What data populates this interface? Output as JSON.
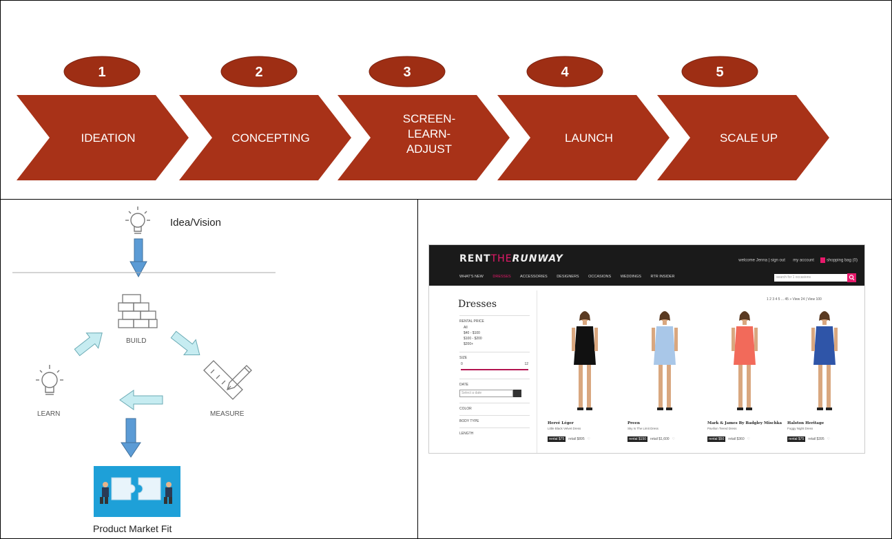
{
  "process": {
    "steps": [
      {
        "number": "1",
        "label": "IDEATION"
      },
      {
        "number": "2",
        "label": "CONCEPTING"
      },
      {
        "number": "3",
        "label_lines": [
          "SCREEN-",
          "LEARN-",
          "ADJUST"
        ]
      },
      {
        "number": "4",
        "label": "LAUNCH"
      },
      {
        "number": "5",
        "label": "SCALE UP"
      }
    ],
    "colors": {
      "chevron": "#a83218",
      "badge": "#9e2e14",
      "text": "#ffffff"
    }
  },
  "lean_cycle": {
    "vision_label": "Idea/Vision",
    "build_label": "BUILD",
    "measure_label": "MEASURE",
    "learn_label": "LEARN",
    "outcome_label": "Product Market Fit",
    "arrow_color": "#5b9bd5",
    "cycle_arrow_color": "#c6ecf1",
    "icons": [
      "lightbulb-icon",
      "brick-wall-icon",
      "ruler-pencil-icon",
      "lightbulb-icon",
      "puzzle-handshake-image"
    ]
  },
  "website": {
    "logo_parts": [
      "RENT",
      "THE",
      "RUNWAY"
    ],
    "header_links": [
      "welcome Jenna | sign out",
      "my account",
      "shopping bag (0)"
    ],
    "nav": [
      "WHAT'S NEW",
      "DRESSES",
      "ACCESSORIES",
      "DESIGNERS",
      "OCCASIONS",
      "WEDDINGS",
      "RTR INSIDER"
    ],
    "search_placeholder": "search for 1 occasions",
    "page_title": "Dresses",
    "pagination": "1 2 3 4 5 ... 45 »  View 24 | View 100",
    "filters": {
      "rental_price": {
        "heading": "RENTAL PRICE",
        "options": [
          "All",
          "$40 - $100",
          "$100 - $200",
          "$200+"
        ]
      },
      "size": {
        "heading": "SIZE",
        "min": "0",
        "max": "12"
      },
      "date": {
        "heading": "DATE",
        "placeholder": "Select a date"
      },
      "more": [
        "COLOR",
        "BODY TYPE",
        "LENGTH"
      ]
    },
    "products": [
      {
        "brand": "Hervé Léger",
        "name": "Little Black Velvet Dress",
        "rental": "rental $75",
        "retail": "retail $895",
        "dress_color": "#111111"
      },
      {
        "brand": "Preen",
        "name": "Sky Is The Limit Dress",
        "rental": "rental $150",
        "retail": "retail $1,600",
        "dress_color": "#a9c7e8"
      },
      {
        "brand": "Mark & James By Badgley Mischka",
        "name": "Pavilion Tiered Dress",
        "rental": "rental $50",
        "retail": "retail $360",
        "dress_color": "#f26a5a"
      },
      {
        "brand": "Halston Heritage",
        "name": "Foggy Night Dress",
        "rental": "rental $75",
        "retail": "retail $395",
        "dress_color": "#2f55a8"
      }
    ],
    "colors": {
      "header_bg": "#1a1a1a",
      "accent": "#e8196b"
    }
  }
}
